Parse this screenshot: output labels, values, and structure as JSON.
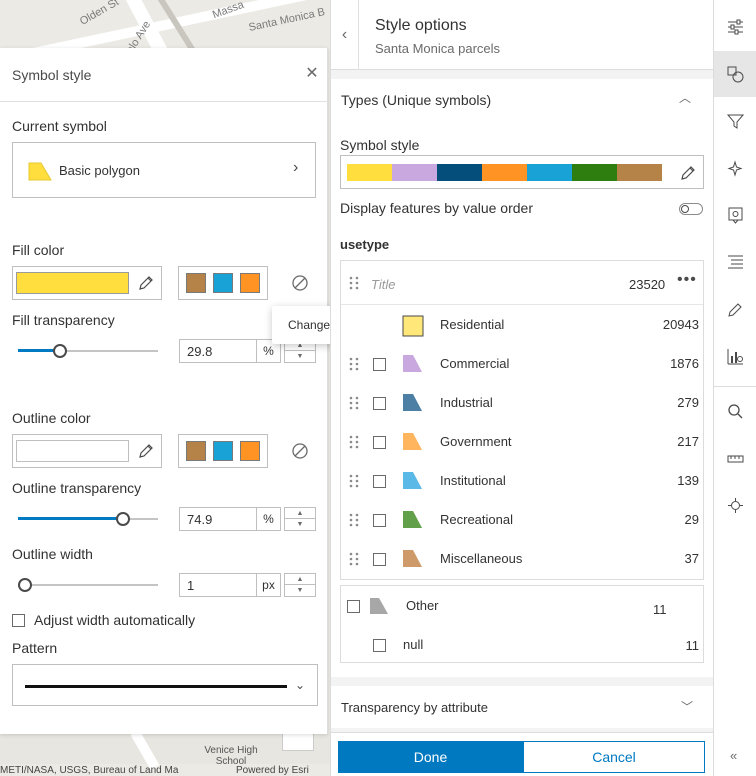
{
  "map": {
    "streets": [
      "Olden St",
      "Massa",
      "Santa Monica B",
      "ublo Ave",
      "Venice High School"
    ],
    "attribution_left": "METI/NASA, USGS, Bureau of Land Ma",
    "attribution_right": "Powered by Esri"
  },
  "symbol_panel": {
    "title": "Symbol style",
    "current_symbol_label": "Current symbol",
    "current_symbol_name": "Basic polygon",
    "fill_color_label": "Fill color",
    "fill_color": "#ffde3e",
    "fill_transparency_label": "Fill transparency",
    "fill_transparency_value": "29.8",
    "fill_transparency_unit": "%",
    "fill_transparency_level": 0.298,
    "outline_color_label": "Outline color",
    "outline_color": "#ffffff",
    "outline_transparency_label": "Outline transparency",
    "outline_transparency_value": "74.9",
    "outline_transparency_unit": "%",
    "outline_transparency_level": 0.749,
    "outline_width_label": "Outline width",
    "outline_width_value": "1",
    "outline_width_unit": "px",
    "outline_width_level": 0.0,
    "adjust_width_label": "Adjust width automatically",
    "pattern_label": "Pattern",
    "quick_colors": [
      "#b58247",
      "#18a2d5",
      "#ff9324"
    ]
  },
  "tooltip": {
    "text": "Change symbol"
  },
  "style_options": {
    "title": "Style options",
    "subtitle": "Santa Monica parcels",
    "types_heading": "Types (Unique symbols)",
    "symbol_style_label": "Symbol style",
    "ramp_colors": [
      "#ffde3e",
      "#c9a8e0",
      "#044e7c",
      "#ff9324",
      "#18a2d5",
      "#2e7d0f",
      "#b58247"
    ],
    "display_by_order_label": "Display features by value order",
    "field_name": "usetype",
    "title_placeholder": "Title",
    "total_count": "23520",
    "rows": [
      {
        "label": "Residential",
        "count": "20943",
        "color": "#ffe77a"
      },
      {
        "label": "Commercial",
        "count": "1876",
        "color": "#c9a8e0"
      },
      {
        "label": "Industrial",
        "count": "279",
        "color": "#4c7fa3"
      },
      {
        "label": "Government",
        "count": "217",
        "color": "#ffb45e"
      },
      {
        "label": "Institutional",
        "count": "139",
        "color": "#5ab9e6"
      },
      {
        "label": "Recreational",
        "count": "29",
        "color": "#62a04a"
      },
      {
        "label": "Miscellaneous",
        "count": "37",
        "color": "#cf9a6a"
      }
    ],
    "other": {
      "label": "Other",
      "count": "11",
      "color": "#a7a7a7"
    },
    "null_row": {
      "label": "null",
      "count": "11"
    },
    "transparency_heading": "Transparency by attribute",
    "done_label": "Done",
    "cancel_label": "Cancel"
  },
  "toolbar": {
    "tools": [
      "properties-icon",
      "styles-icon",
      "filter-icon",
      "effects-icon",
      "configure-popups-icon",
      "labels-icon",
      "sketch-icon",
      "charts-icon",
      "search-icon",
      "measure-icon",
      "location-icon"
    ]
  }
}
